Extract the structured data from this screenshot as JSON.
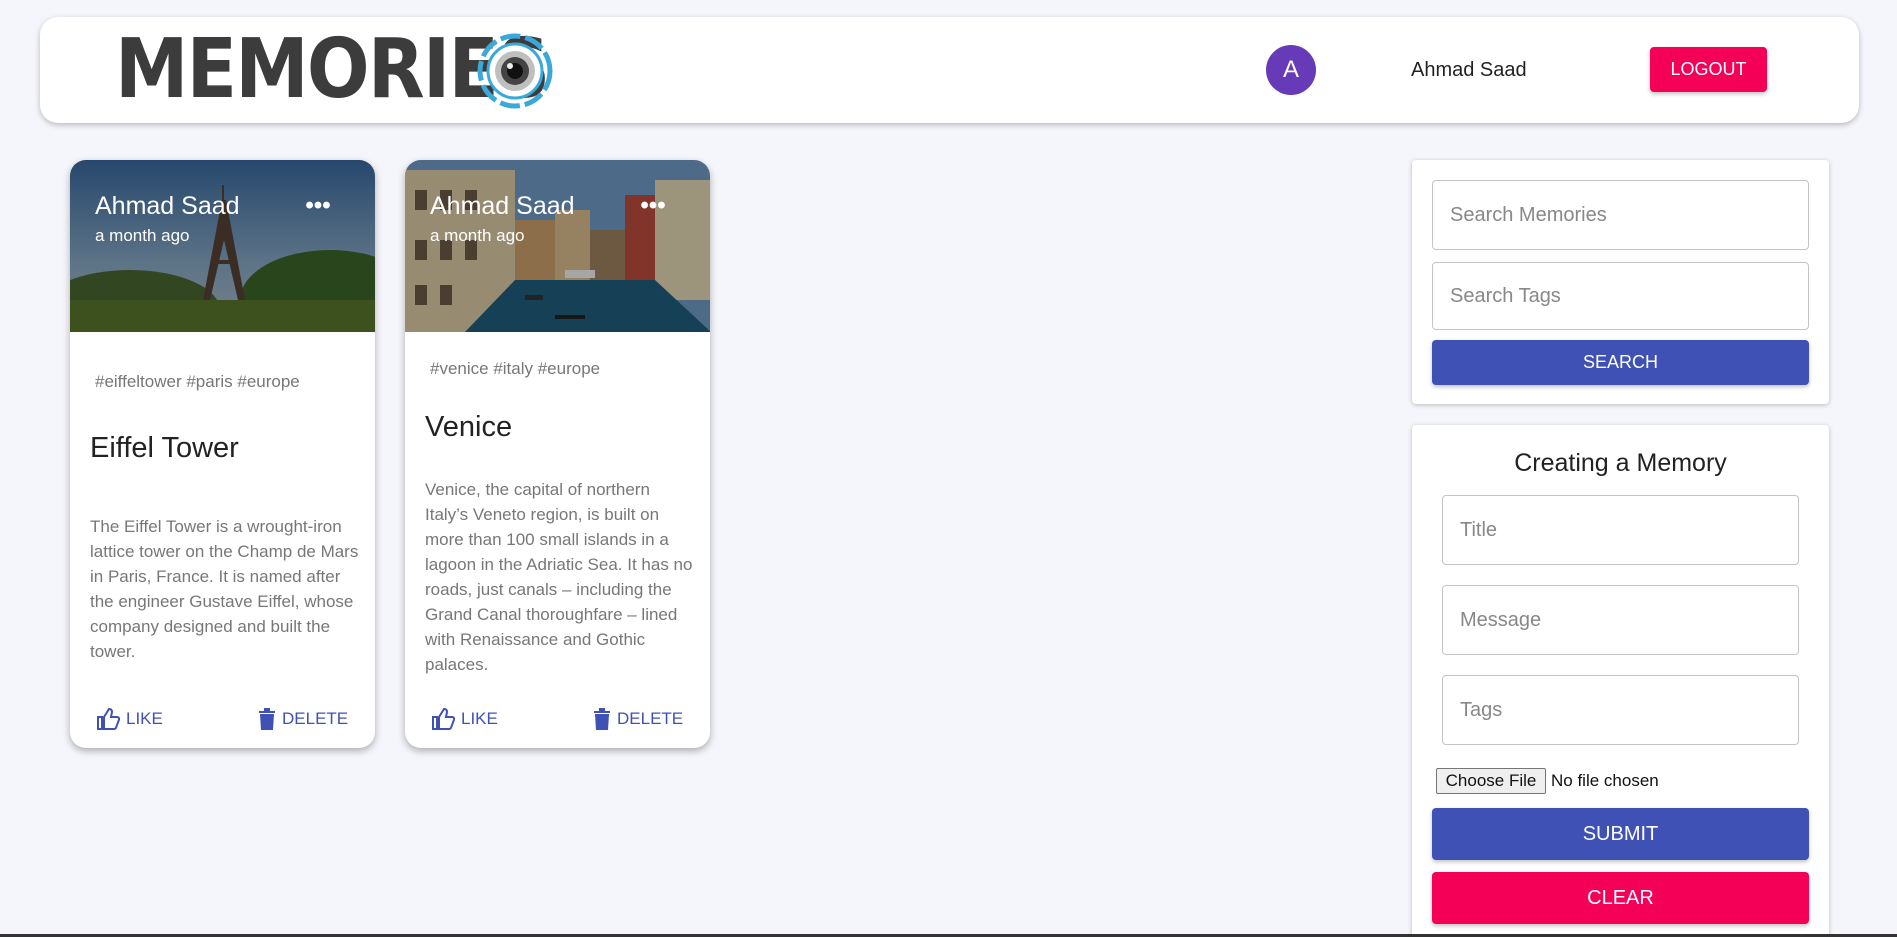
{
  "appbar": {
    "logo_text": "MEMORIES",
    "avatar_letter": "A",
    "username": "Ahmad Saad",
    "logout_label": "LOGOUT"
  },
  "posts": [
    {
      "author": "Ahmad Saad",
      "time": "a month ago",
      "more": "•••",
      "tags": "#eiffeltower #paris #europe",
      "title": "Eiffel Tower",
      "message": "The Eiffel Tower is a wrought-iron lattice tower on the Champ de Mars in Paris, France. It is named after the engineer Gustave Eiffel, whose company designed and built the tower.",
      "like_label": "LIKE",
      "delete_label": "DELETE"
    },
    {
      "author": "Ahmad Saad",
      "time": "a month ago",
      "more": "•••",
      "tags": "#venice #italy #europe",
      "title": "Venice",
      "message": "Venice, the capital of northern Italy’s Veneto region, is built on more than 100 small islands in a lagoon in the Adriatic Sea. It has no roads, just canals – including the Grand Canal thoroughfare – lined with Renaissance and Gothic palaces.",
      "like_label": "LIKE",
      "delete_label": "DELETE"
    }
  ],
  "search": {
    "memories_placeholder": "Search Memories",
    "tags_placeholder": "Search Tags",
    "button_label": "SEARCH"
  },
  "form": {
    "title": "Creating a Memory",
    "title_placeholder": "Title",
    "message_placeholder": "Message",
    "tags_placeholder": "Tags",
    "file_button": "Choose File",
    "file_status": "No file chosen",
    "submit_label": "SUBMIT",
    "clear_label": "CLEAR"
  },
  "colors": {
    "primary": "#3f51b5",
    "secondary": "#f50057",
    "avatar": "#673ab7",
    "background": "#f5f6fb"
  },
  "icons": [
    "camera-lens-icon",
    "more-horizontal-icon",
    "thumb-up-icon",
    "delete-icon"
  ]
}
